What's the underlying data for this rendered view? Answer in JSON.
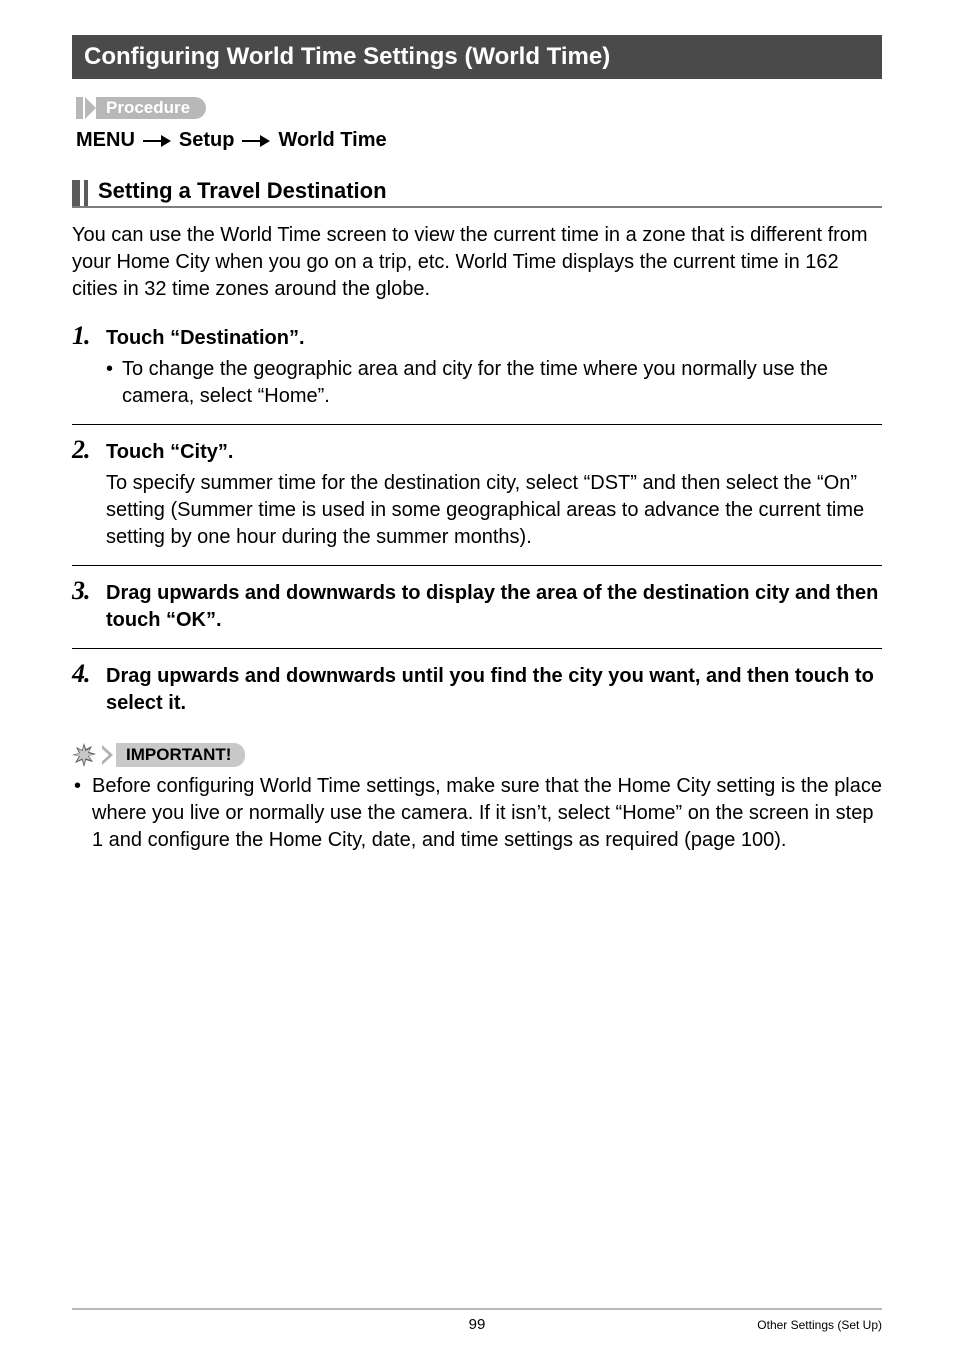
{
  "section_title": "Configuring World Time Settings (World Time)",
  "procedure_label": "Procedure",
  "menu_path": {
    "p1": "MENU",
    "p2": "Setup",
    "p3": "World Time"
  },
  "sub_header": "Setting a Travel Destination",
  "intro_text": "You can use the World Time screen to view the current time in a zone that is different from your Home City when you go on a trip, etc. World Time displays the current time in 162 cities in 32 time zones around the globe.",
  "steps": [
    {
      "num": "1.",
      "title": "Touch “Destination”.",
      "bullet": "To change the geographic area and city for the time where you normally use the camera, select “Home”."
    },
    {
      "num": "2.",
      "title": "Touch “City”.",
      "body": "To specify summer time for the destination city, select “DST” and then select the “On” setting (Summer time is used in some geographical areas to advance the current time setting by one hour during the summer months)."
    },
    {
      "num": "3.",
      "title": "Drag upwards and downwards to display the area of the destination city and then touch “OK”."
    },
    {
      "num": "4.",
      "title": "Drag upwards and downwards until you find the city you want, and then touch to select it."
    }
  ],
  "important_label": "IMPORTANT!",
  "important_note": "Before configuring World Time settings, make sure that the Home City setting is the place where you live or normally use the camera. If it isn’t, select “Home” on the screen in step 1 and configure the Home City, date, and time settings as required (page 100).",
  "footer": {
    "page_num": "99",
    "right": "Other Settings (Set Up)"
  }
}
